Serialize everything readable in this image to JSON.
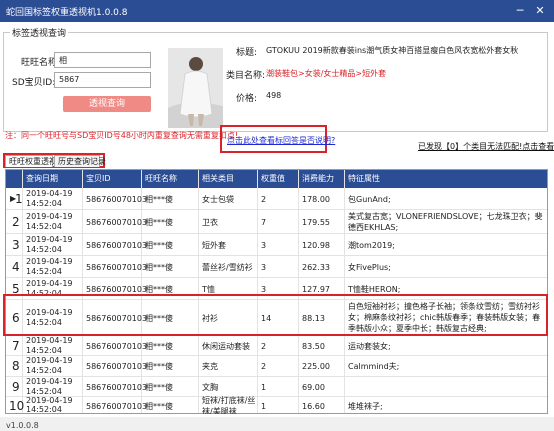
{
  "window": {
    "title": "蛇回国标签权重透视机1.0.0.8",
    "min_glyph": "─",
    "close_glyph": "✕",
    "accent": "#2b4d94"
  },
  "query": {
    "group_title": "标签透视查询",
    "wangwang_label": "旺旺名称:",
    "wangwang_value": "相",
    "sd_label": "SD宝贝ID:",
    "sd_value": "5867",
    "query_button": "透视查询",
    "tip": "注：同一个旺旺号与SD宝贝ID号48小时内重复查询无需重复扣点!"
  },
  "product": {
    "title_label": "标题:",
    "title_value": "GTOKUU 2019新款春装ins潮气质女神百搭显瘦白色风衣宽松外套女秋",
    "category_label": "类目名称:",
    "category_value": "潮装鞋包>女装/女士精品>短外套",
    "price_label": "价格:",
    "price_value": "498"
  },
  "links": {
    "reference": "点击此处查看标回答是否说明?",
    "found": "已发现【0】个类目无法匹配!点击查看"
  },
  "tabs": [
    {
      "label": "旺旺权重透视"
    },
    {
      "label": "历史查询记录"
    }
  ],
  "table": {
    "columns": [
      "查询日期",
      "宝贝ID",
      "旺旺名称",
      "相关类目",
      "权重值",
      "消费能力",
      "特征属性"
    ],
    "selected_marker": "▶",
    "rows": [
      {
        "idx": "1",
        "date": "2019-04-19",
        "time": "14:52:04",
        "id": "586760070103",
        "name": "相***傻",
        "cat": "女士包袋",
        "weight": "2",
        "spend": "178.00",
        "attr": "包GunAnd;"
      },
      {
        "idx": "2",
        "date": "2019-04-19",
        "time": "14:52:04",
        "id": "586760070103",
        "name": "相***傻",
        "cat": "卫衣",
        "weight": "7",
        "spend": "179.55",
        "attr": "美式复古宽；VLONEFRIENDSLOVE；七龙珠卫衣；斐德西EKHLAS;"
      },
      {
        "idx": "3",
        "date": "2019-04-19",
        "time": "14:52:04",
        "id": "586760070103",
        "name": "相***傻",
        "cat": "短外套",
        "weight": "3",
        "spend": "120.98",
        "attr": "潮tom2019;"
      },
      {
        "idx": "4",
        "date": "2019-04-19",
        "time": "14:52:04",
        "id": "586760070103",
        "name": "相***傻",
        "cat": "蕾丝衫/雪纺衫",
        "weight": "3",
        "spend": "262.33",
        "attr": "女FivePlus;"
      },
      {
        "idx": "5",
        "date": "2019-04-19",
        "time": "14:52:04",
        "id": "586760070103",
        "name": "相***傻",
        "cat": "T恤",
        "weight": "3",
        "spend": "127.97",
        "attr": "T恤鞋HERON;"
      },
      {
        "idx": "6",
        "date": "2019-04-19",
        "time": "14:52:04",
        "id": "586760070103",
        "name": "相***傻",
        "cat": "衬衫",
        "weight": "14",
        "spend": "88.13",
        "attr": "白色短袖衬衫；撞色格子长袖；领条纹雪纺；雪纺衬衫女；棉麻条纹衬衫；chic韩版春季；春装韩版女装；春季韩版小众；夏季中长；韩版复古经典;"
      },
      {
        "idx": "7",
        "date": "2019-04-19",
        "time": "14:52:04",
        "id": "586760070103",
        "name": "相***傻",
        "cat": "休闲运动套装",
        "weight": "2",
        "spend": "83.50",
        "attr": "运动套装女;"
      },
      {
        "idx": "8",
        "date": "2019-04-19",
        "time": "14:52:04",
        "id": "586760070103",
        "name": "相***傻",
        "cat": "夹克",
        "weight": "2",
        "spend": "225.00",
        "attr": "Calmmind夫;"
      },
      {
        "idx": "9",
        "date": "2019-04-19",
        "time": "14:52:04",
        "id": "586760070103",
        "name": "相***傻",
        "cat": "文胸",
        "weight": "1",
        "spend": "69.00",
        "attr": ""
      },
      {
        "idx": "10",
        "date": "2019-04-19",
        "time": "14:52:04",
        "id": "586760070103",
        "name": "相***傻",
        "cat": "短袜/打底袜/丝袜/美腿袜",
        "weight": "1",
        "spend": "16.60",
        "attr": "堆堆袜子;"
      }
    ]
  },
  "footer": {
    "version": "v1.0.0.8"
  }
}
